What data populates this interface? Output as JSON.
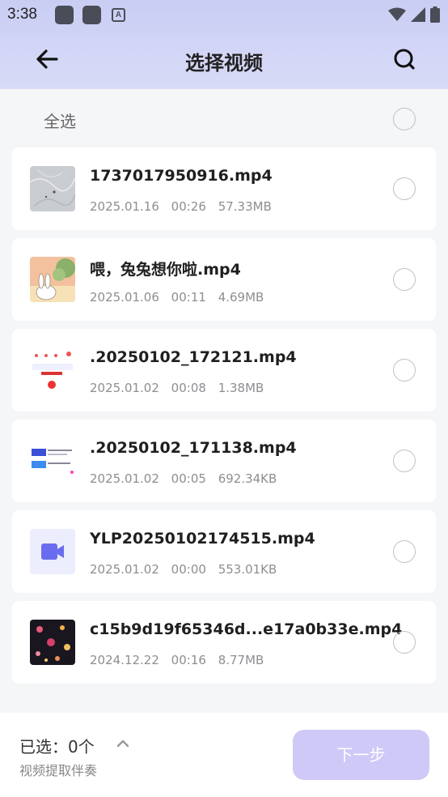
{
  "status_bar": {
    "time": "3:38",
    "left_icons": [
      "app-icon",
      "app-icon",
      "a-icon"
    ],
    "right_icons": [
      "wifi-icon",
      "signal-icon",
      "battery-icon"
    ]
  },
  "header": {
    "title": "选择视频",
    "back_icon": "arrow-left-icon",
    "search_icon": "search-icon"
  },
  "select_all": {
    "label": "全选",
    "checked": false
  },
  "videos": [
    {
      "name": "1737017950916.mp4",
      "date": "2025.01.16",
      "duration": "00:26",
      "size": "57.33MB",
      "thumb": "gray-texture",
      "checked": false
    },
    {
      "name": "喂，兔兔想你啦.mp4",
      "date": "2025.01.06",
      "duration": "00:11",
      "size": "4.69MB",
      "thumb": "bunny-illustration",
      "checked": false
    },
    {
      "name": ".20250102_172121.mp4",
      "date": "2025.01.02",
      "duration": "00:08",
      "size": "1.38MB",
      "thumb": "ui-screenshot",
      "checked": false
    },
    {
      "name": ".20250102_171138.mp4",
      "date": "2025.01.02",
      "duration": "00:05",
      "size": "692.34KB",
      "thumb": "ui-screenshot-blue",
      "checked": false
    },
    {
      "name": "YLP20250102174515.mp4",
      "date": "2025.01.02",
      "duration": "00:00",
      "size": "553.01KB",
      "thumb": "video-camera-icon",
      "checked": false
    },
    {
      "name": "c15b9d19f65346d...e17a0b33e.mp4",
      "date": "2024.12.22",
      "duration": "00:16",
      "size": "8.77MB",
      "thumb": "dark-flowers",
      "checked": false
    }
  ],
  "footer": {
    "selected_label": "已选：0个",
    "subtext": "视频提取伴奏",
    "next_button": "下一步",
    "chevron_icon": "chevron-up-icon"
  },
  "colors": {
    "header_gradient_top": "#c9cdf3",
    "next_button_bg": "#cfc9f7",
    "camera_icon": "#6a6cf0",
    "page_bg": "#f5f6f8"
  }
}
